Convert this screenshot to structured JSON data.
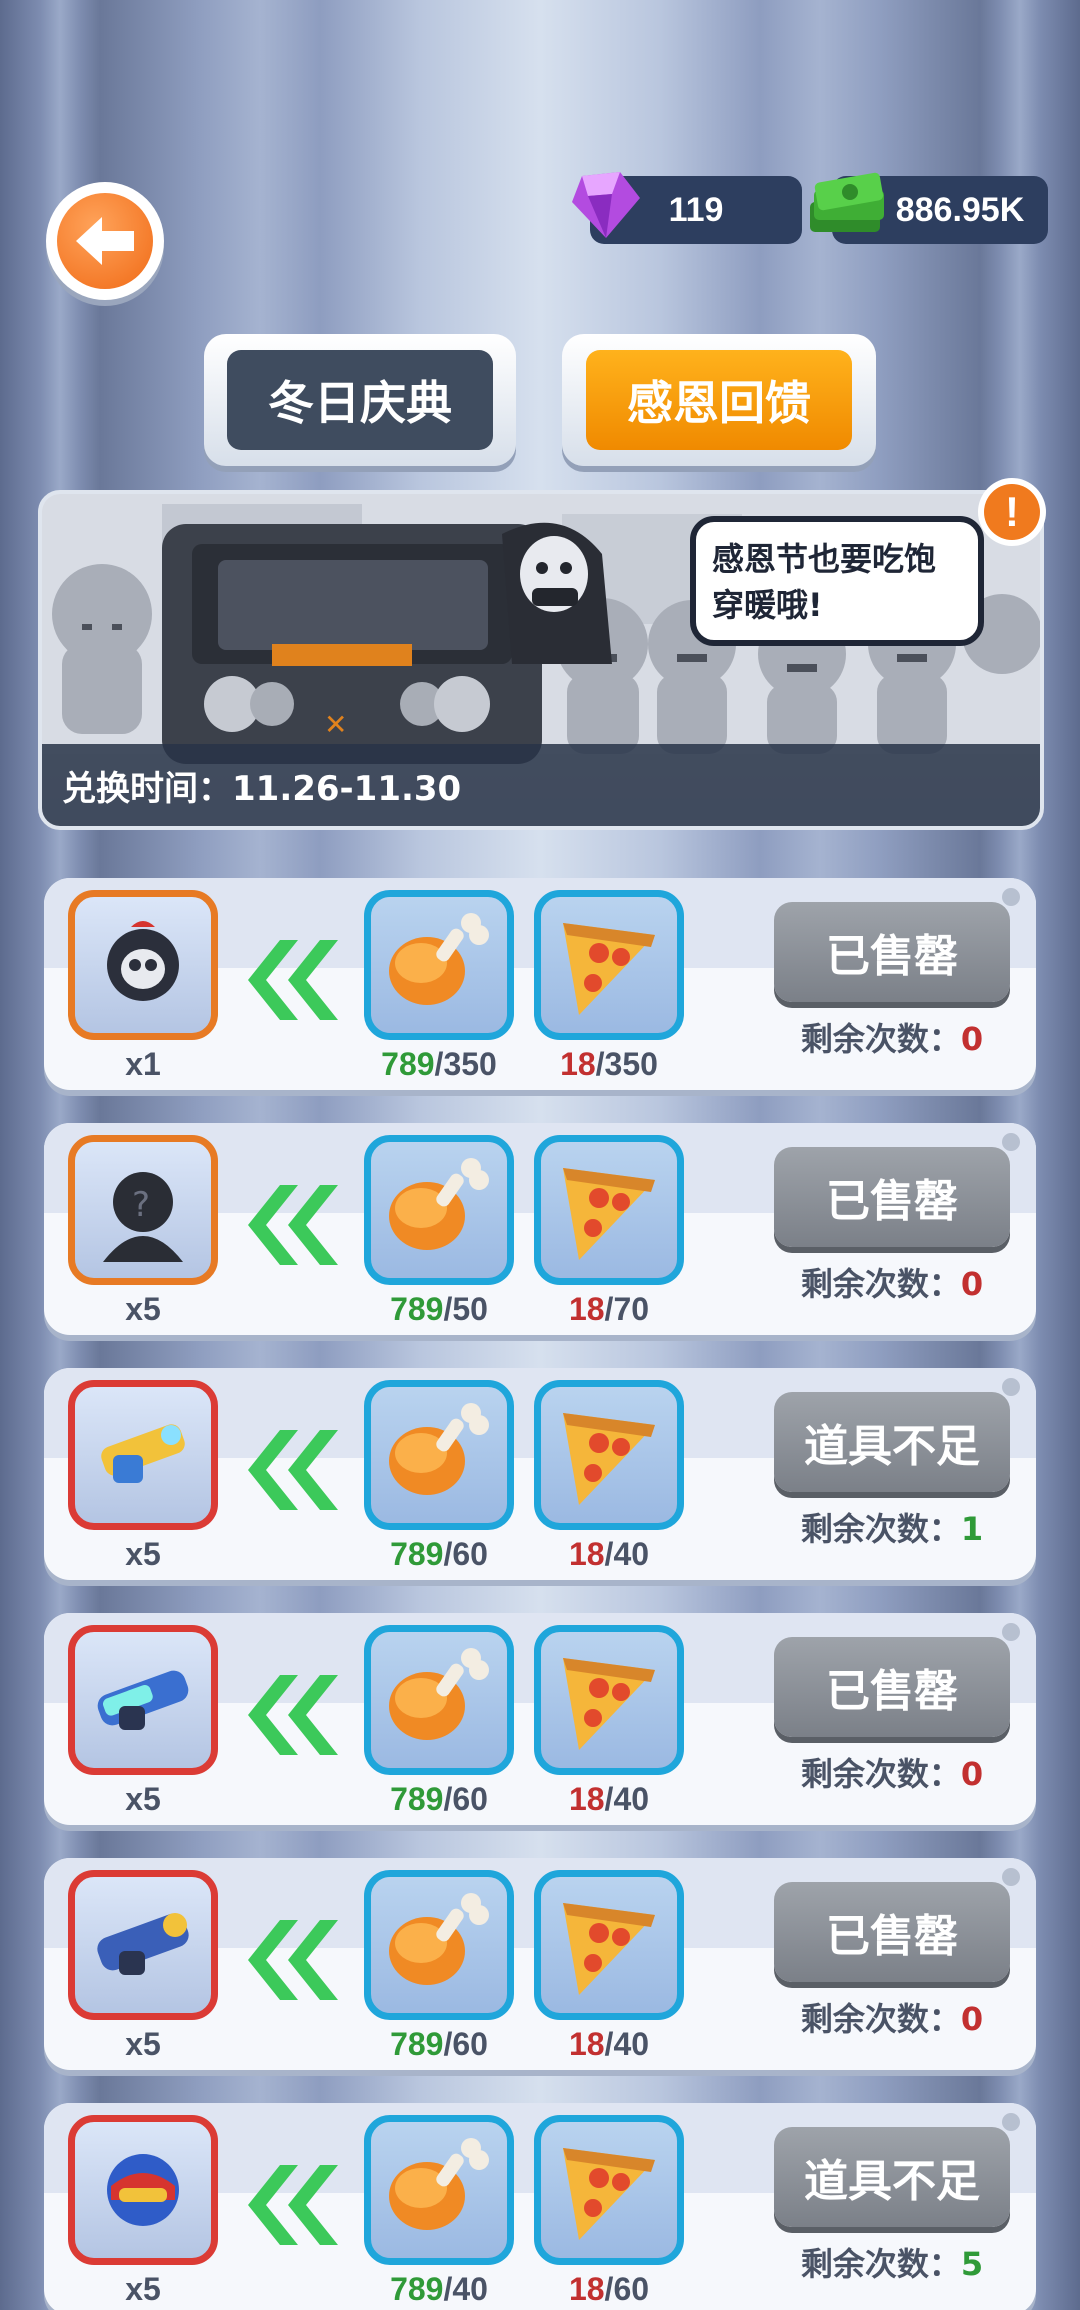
{
  "currency": {
    "gems": "119",
    "cash": "886.95K"
  },
  "tabs": [
    {
      "label": "冬日庆典",
      "active": false
    },
    {
      "label": "感恩回馈",
      "active": true
    }
  ],
  "banner": {
    "speech": "感恩节也要吃饱穿暖哦!",
    "time_label": "兑换时间：11.26-11.30"
  },
  "remain_label": "剩余次数：",
  "rows": [
    {
      "reward_qty": "x1",
      "reward_icon": "skull-helmet-character-icon",
      "reward_border": "orange",
      "cost1": {
        "icon": "drumstick-icon",
        "have": "789",
        "need": "/350"
      },
      "cost2": {
        "icon": "pizza-slice-icon",
        "have": "18",
        "need": "/350"
      },
      "button": "已售罄",
      "remain": "0"
    },
    {
      "reward_qty": "x5",
      "reward_icon": "mystery-character-icon",
      "reward_border": "orange",
      "cost1": {
        "icon": "drumstick-icon",
        "have": "789",
        "need": "/50"
      },
      "cost2": {
        "icon": "pizza-slice-icon",
        "have": "18",
        "need": "/70"
      },
      "button": "已售罄",
      "remain": "0"
    },
    {
      "reward_qty": "x5",
      "reward_icon": "yellow-blaster-icon",
      "reward_border": "red",
      "cost1": {
        "icon": "drumstick-icon",
        "have": "789",
        "need": "/60"
      },
      "cost2": {
        "icon": "pizza-slice-icon",
        "have": "18",
        "need": "/40"
      },
      "button": "道具不足",
      "remain": "1"
    },
    {
      "reward_qty": "x5",
      "reward_icon": "cyan-cannon-icon",
      "reward_border": "red",
      "cost1": {
        "icon": "drumstick-icon",
        "have": "789",
        "need": "/60"
      },
      "cost2": {
        "icon": "pizza-slice-icon",
        "have": "18",
        "need": "/40"
      },
      "button": "已售罄",
      "remain": "0"
    },
    {
      "reward_qty": "x5",
      "reward_icon": "blue-launcher-icon",
      "reward_border": "red",
      "cost1": {
        "icon": "drumstick-icon",
        "have": "789",
        "need": "/60"
      },
      "cost2": {
        "icon": "pizza-slice-icon",
        "have": "18",
        "need": "/40"
      },
      "button": "已售罄",
      "remain": "0"
    },
    {
      "reward_qty": "x5",
      "reward_icon": "red-helmet-icon",
      "reward_border": "red",
      "cost1": {
        "icon": "drumstick-icon",
        "have": "789",
        "need": "/40"
      },
      "cost2": {
        "icon": "pizza-slice-icon",
        "have": "18",
        "need": "/60"
      },
      "button": "道具不足",
      "remain": "5"
    }
  ]
}
